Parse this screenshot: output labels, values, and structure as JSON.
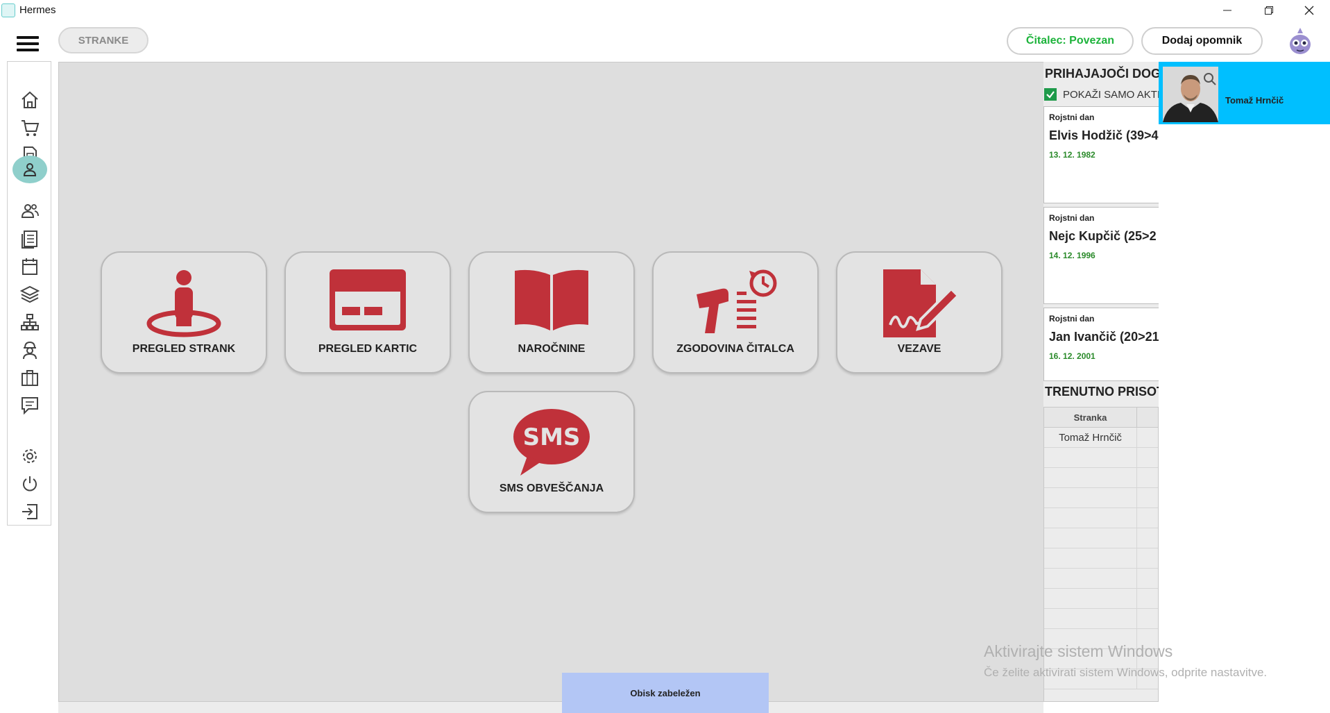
{
  "window": {
    "title": "Hermes"
  },
  "header": {
    "nav_button": "STRANKE",
    "reader_status": "Čitalec: Povezan",
    "add_reminder": "Dodaj opomnik"
  },
  "sidebar": {
    "items": [
      {
        "icon": "home-icon"
      },
      {
        "icon": "cart-icon"
      },
      {
        "icon": "document-icon"
      },
      {
        "icon": "person-icon",
        "active": true
      },
      {
        "icon": "people-icon"
      },
      {
        "icon": "list-document-icon"
      },
      {
        "icon": "calendar-icon"
      },
      {
        "icon": "layers-icon"
      },
      {
        "icon": "hierarchy-icon"
      },
      {
        "icon": "worker-icon"
      },
      {
        "icon": "briefcase-icon"
      },
      {
        "icon": "chat-icon"
      },
      {
        "icon": "gear-icon"
      },
      {
        "icon": "power-icon"
      },
      {
        "icon": "logout-icon"
      }
    ]
  },
  "tiles": [
    {
      "label": "PREGLED STRANK",
      "icon": "person-location-icon"
    },
    {
      "label": "PREGLED KARTIC",
      "icon": "card-icon"
    },
    {
      "label": "NAROČNINE",
      "icon": "book-icon"
    },
    {
      "label": "ZGODOVINA ČITALCA",
      "icon": "scanner-history-icon"
    },
    {
      "label": "VEZAVE",
      "icon": "signed-document-icon"
    },
    {
      "label": "SMS OBVEŠČANJA",
      "icon": "sms-bubble-icon",
      "icon_text": "SMS"
    }
  ],
  "right_panel": {
    "upcoming_title": "PRIHAJAJOČI DOGO",
    "only_active_label": "POKAŽI SAMO AKTIV",
    "events": [
      {
        "type": "Rojstni dan",
        "name": "Elvis Hodžič (39>4",
        "date": "13. 12. 1982"
      },
      {
        "type": "Rojstni dan",
        "name": "Nejc Kupčič (25>2",
        "date": "14. 12. 1996"
      },
      {
        "type": "Rojstni dan",
        "name": "Jan Ivančič (20>21",
        "date": "16. 12. 2001"
      }
    ],
    "present_title": "TRENUTNO PRISOT",
    "present_table": {
      "column": "Stranka",
      "rows": [
        "Tomaž Hrnčič"
      ]
    }
  },
  "popup": {
    "name": "Tomaž Hrnčič"
  },
  "toast": {
    "text": "Obisk zabeležen"
  },
  "watermark": {
    "title": "Aktivirajte sistem Windows",
    "subtitle": "Če želite aktivirati sistem Windows, odprite nastavitve."
  },
  "colors": {
    "accent_red": "#c0313a",
    "active_teal": "#8fcfcb",
    "popup_blue": "#00bfff",
    "toast_blue": "#b3c6f5",
    "status_green": "#1db33b"
  }
}
